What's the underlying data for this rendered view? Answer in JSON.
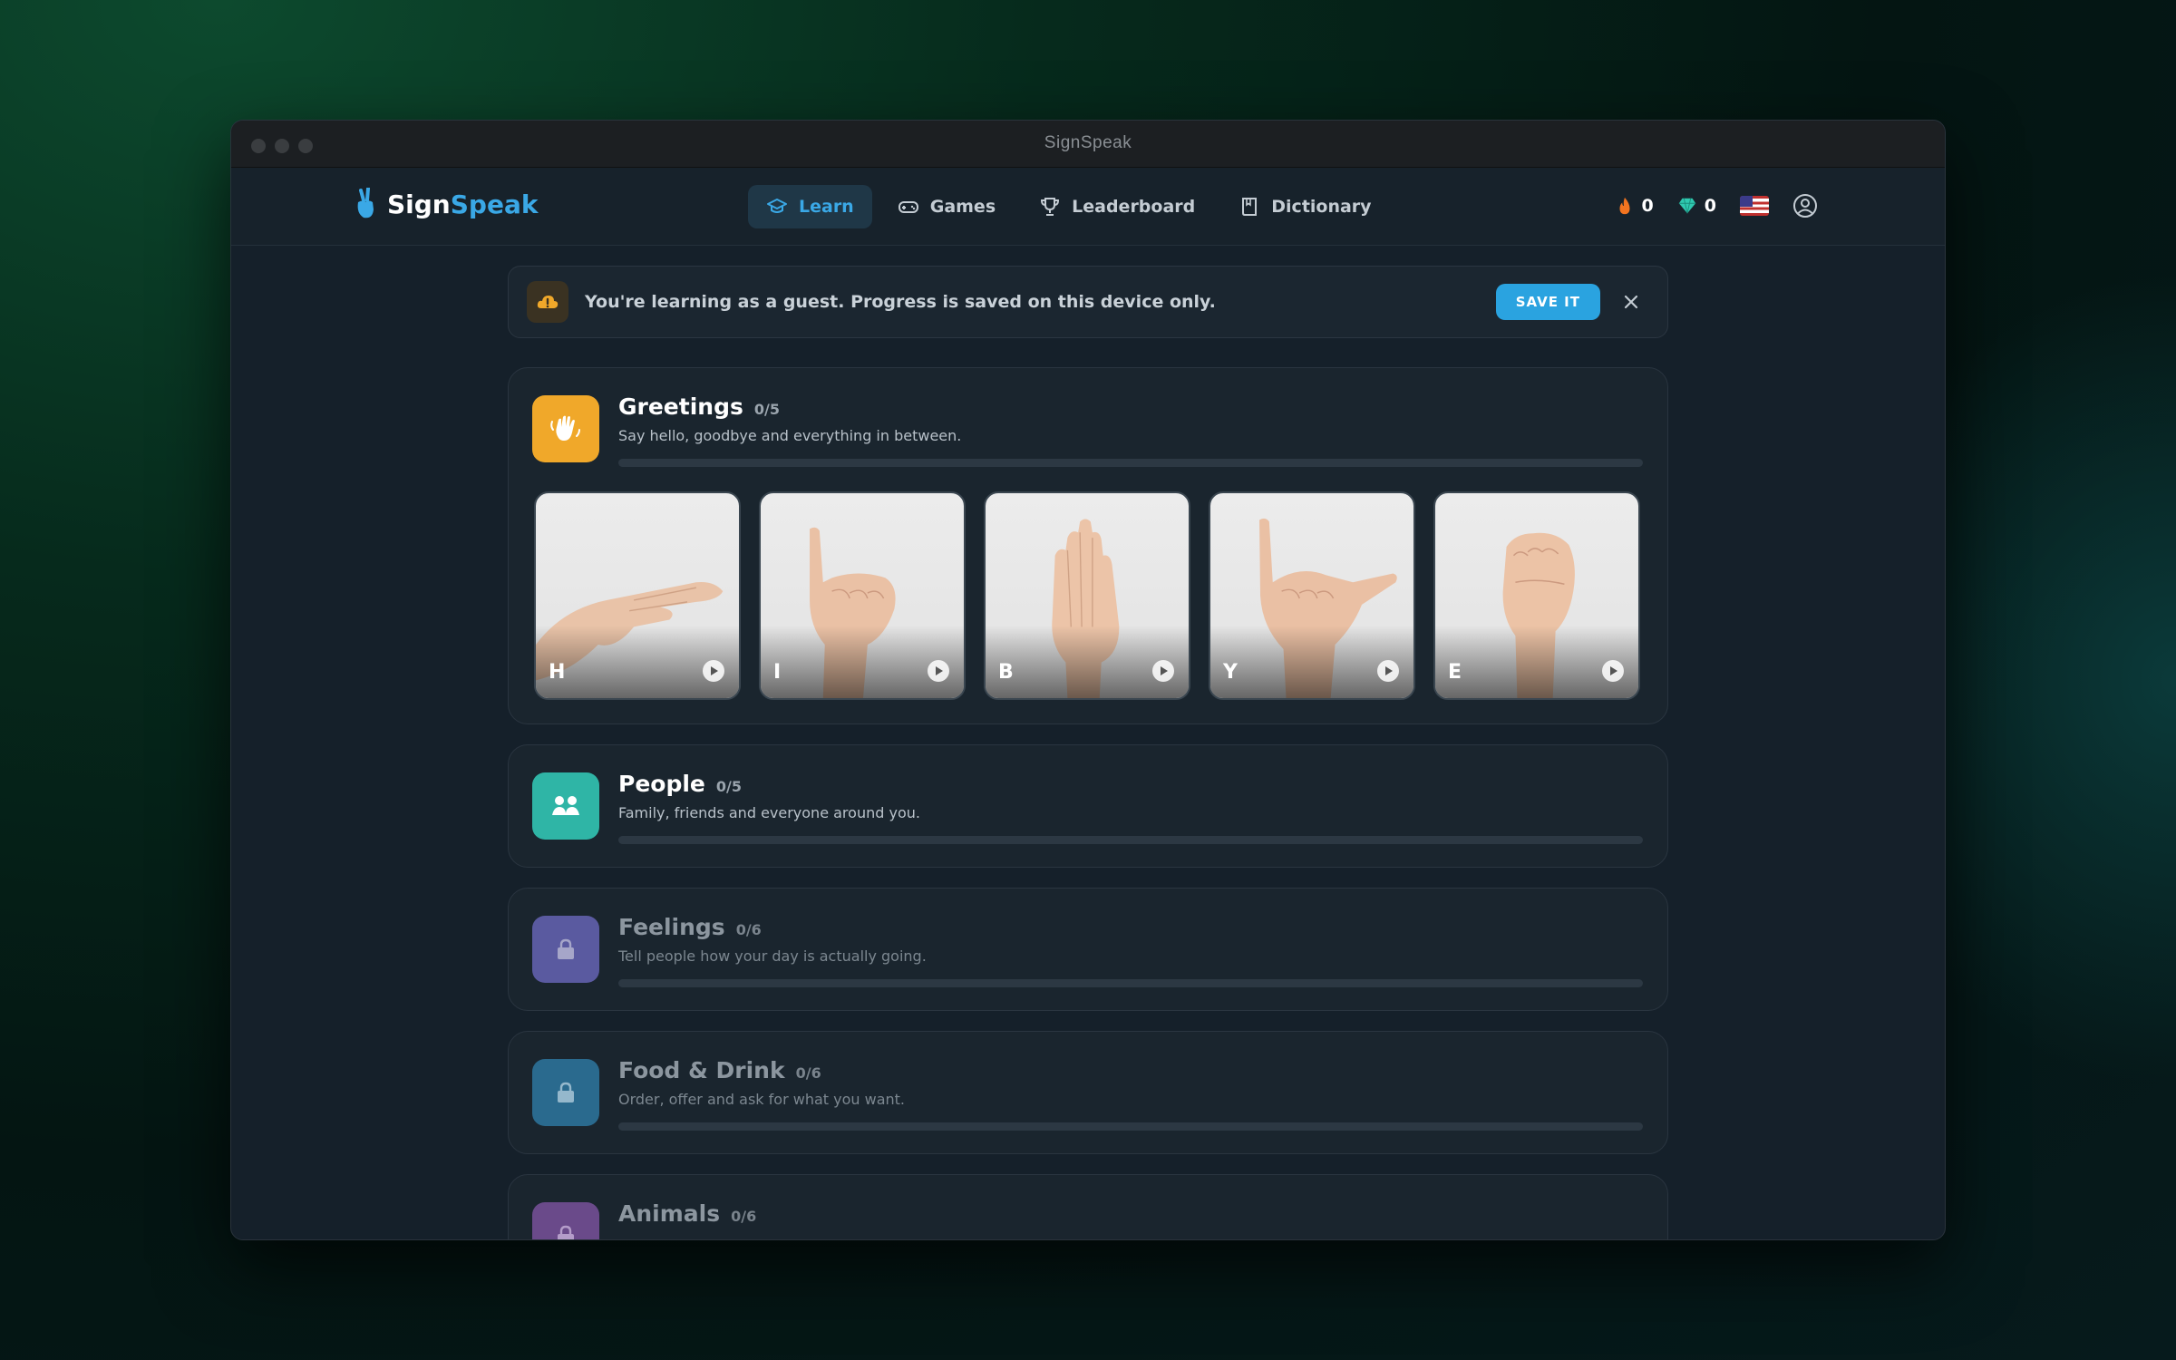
{
  "window": {
    "title": "SignSpeak"
  },
  "brand": {
    "name_part1": "Sign",
    "name_part2": "Speak"
  },
  "nav": [
    {
      "label": "Learn",
      "icon": "graduation-cap-icon",
      "active": true
    },
    {
      "label": "Games",
      "icon": "gamepad-icon",
      "active": false
    },
    {
      "label": "Leaderboard",
      "icon": "trophy-icon",
      "active": false
    },
    {
      "label": "Dictionary",
      "icon": "book-icon",
      "active": false
    }
  ],
  "stats": {
    "streak": "0",
    "gems": "0"
  },
  "banner": {
    "text": "You're learning as a guest. Progress is saved on this device only.",
    "button": "SAVE IT"
  },
  "units": [
    {
      "title": "Greetings",
      "count": "0/5",
      "subtitle": "Say hello, goodbye and everything in between.",
      "color": "#f0a82a",
      "locked": false,
      "progress": 0,
      "cards": [
        "H",
        "I",
        "B",
        "Y",
        "E"
      ]
    },
    {
      "title": "People",
      "count": "0/5",
      "subtitle": "Family, friends and everyone around you.",
      "color": "#2fb5a6",
      "locked": false,
      "progress": 0
    },
    {
      "title": "Feelings",
      "count": "0/6",
      "subtitle": "Tell people how your day is actually going.",
      "color": "#5a5aa0",
      "locked": true,
      "progress": 0
    },
    {
      "title": "Food & Drink",
      "count": "0/6",
      "subtitle": "Order, offer and ask for what you want.",
      "color": "#2a6a8e",
      "locked": true,
      "progress": 0
    },
    {
      "title": "Animals",
      "count": "0/6",
      "subtitle": "",
      "color": "#6a4a8a",
      "locked": true,
      "progress": 0
    }
  ]
}
